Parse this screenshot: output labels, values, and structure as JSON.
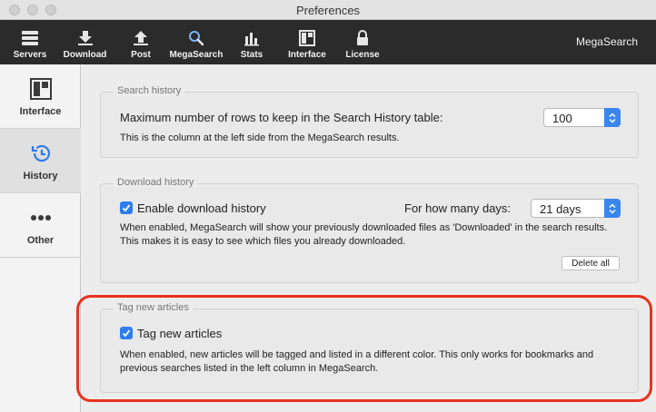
{
  "window": {
    "title": "Preferences"
  },
  "toolbar": {
    "items": [
      {
        "label": "Servers",
        "icon": "servers-icon"
      },
      {
        "label": "Download",
        "icon": "download-icon"
      },
      {
        "label": "Post",
        "icon": "post-icon"
      },
      {
        "label": "MegaSearch",
        "icon": "search-icon"
      },
      {
        "label": "Stats",
        "icon": "stats-icon"
      },
      {
        "label": "Interface",
        "icon": "interface-icon"
      },
      {
        "label": "License",
        "icon": "license-icon"
      }
    ],
    "app_name": "MegaSearch"
  },
  "sidebar": {
    "items": [
      {
        "label": "Interface",
        "icon": "interface-icon"
      },
      {
        "label": "History",
        "icon": "history-icon",
        "selected": true
      },
      {
        "label": "Other",
        "icon": "more-icon"
      }
    ]
  },
  "search_history": {
    "legend": "Search history",
    "label": "Maximum number of rows to keep in the Search History table:",
    "rows_value": "100",
    "description": "This is the column at the left side from the MegaSearch results."
  },
  "download_history": {
    "legend": "Download history",
    "enable_label": "Enable download history",
    "enabled": true,
    "days_label": "For how many days:",
    "days_value": "21 days",
    "description": "When enabled, MegaSearch will show your previously downloaded files as 'Downloaded' in the search results. This makes it is easy to see which files you already downloaded.",
    "delete_label": "Delete all"
  },
  "tag_articles": {
    "legend": "Tag new articles",
    "checkbox_label": "Tag new articles",
    "enabled": true,
    "description": "When enabled, new articles will be tagged and listed in a different color. This only works for bookmarks and previous searches listed in the left column in MegaSearch."
  },
  "colors": {
    "accent": "#2f7cf0",
    "highlight": "#e8321e",
    "toolbar_bg": "#2b2b2b"
  }
}
